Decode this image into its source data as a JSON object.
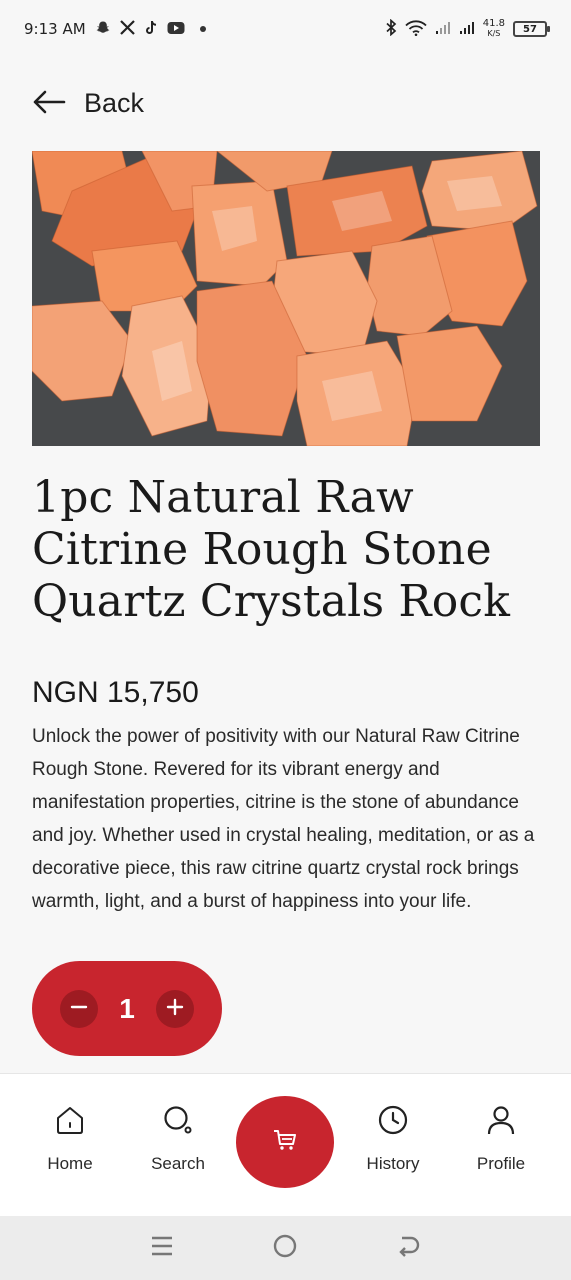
{
  "status_bar": {
    "time": "9:13 AM",
    "network_speed_value": "41.8",
    "network_speed_unit": "K/S",
    "battery_level": "57"
  },
  "header": {
    "back_label": "Back"
  },
  "product": {
    "title": "1pc Natural Raw Citrine Rough Stone Quartz Crystals Rock",
    "price": "NGN 15,750",
    "description": "Unlock the power of positivity with our Natural Raw Citrine Rough Stone. Revered for its vibrant energy and manifestation properties, citrine is the stone of abundance and joy. Whether used in crystal healing, meditation, or as a decorative piece, this raw citrine quartz crystal rock brings warmth, light, and a burst of happiness into your life."
  },
  "quantity": {
    "value": "1"
  },
  "bottom_nav": {
    "items": [
      {
        "label": "Home",
        "icon": "home-icon"
      },
      {
        "label": "Search",
        "icon": "search-icon"
      },
      {
        "label": "",
        "icon": "cart-icon"
      },
      {
        "label": "History",
        "icon": "clock-icon"
      },
      {
        "label": "Profile",
        "icon": "user-icon"
      }
    ]
  },
  "colors": {
    "accent": "#c8252e",
    "accent_dark": "#9e1b22",
    "background": "#f7f7f7"
  }
}
